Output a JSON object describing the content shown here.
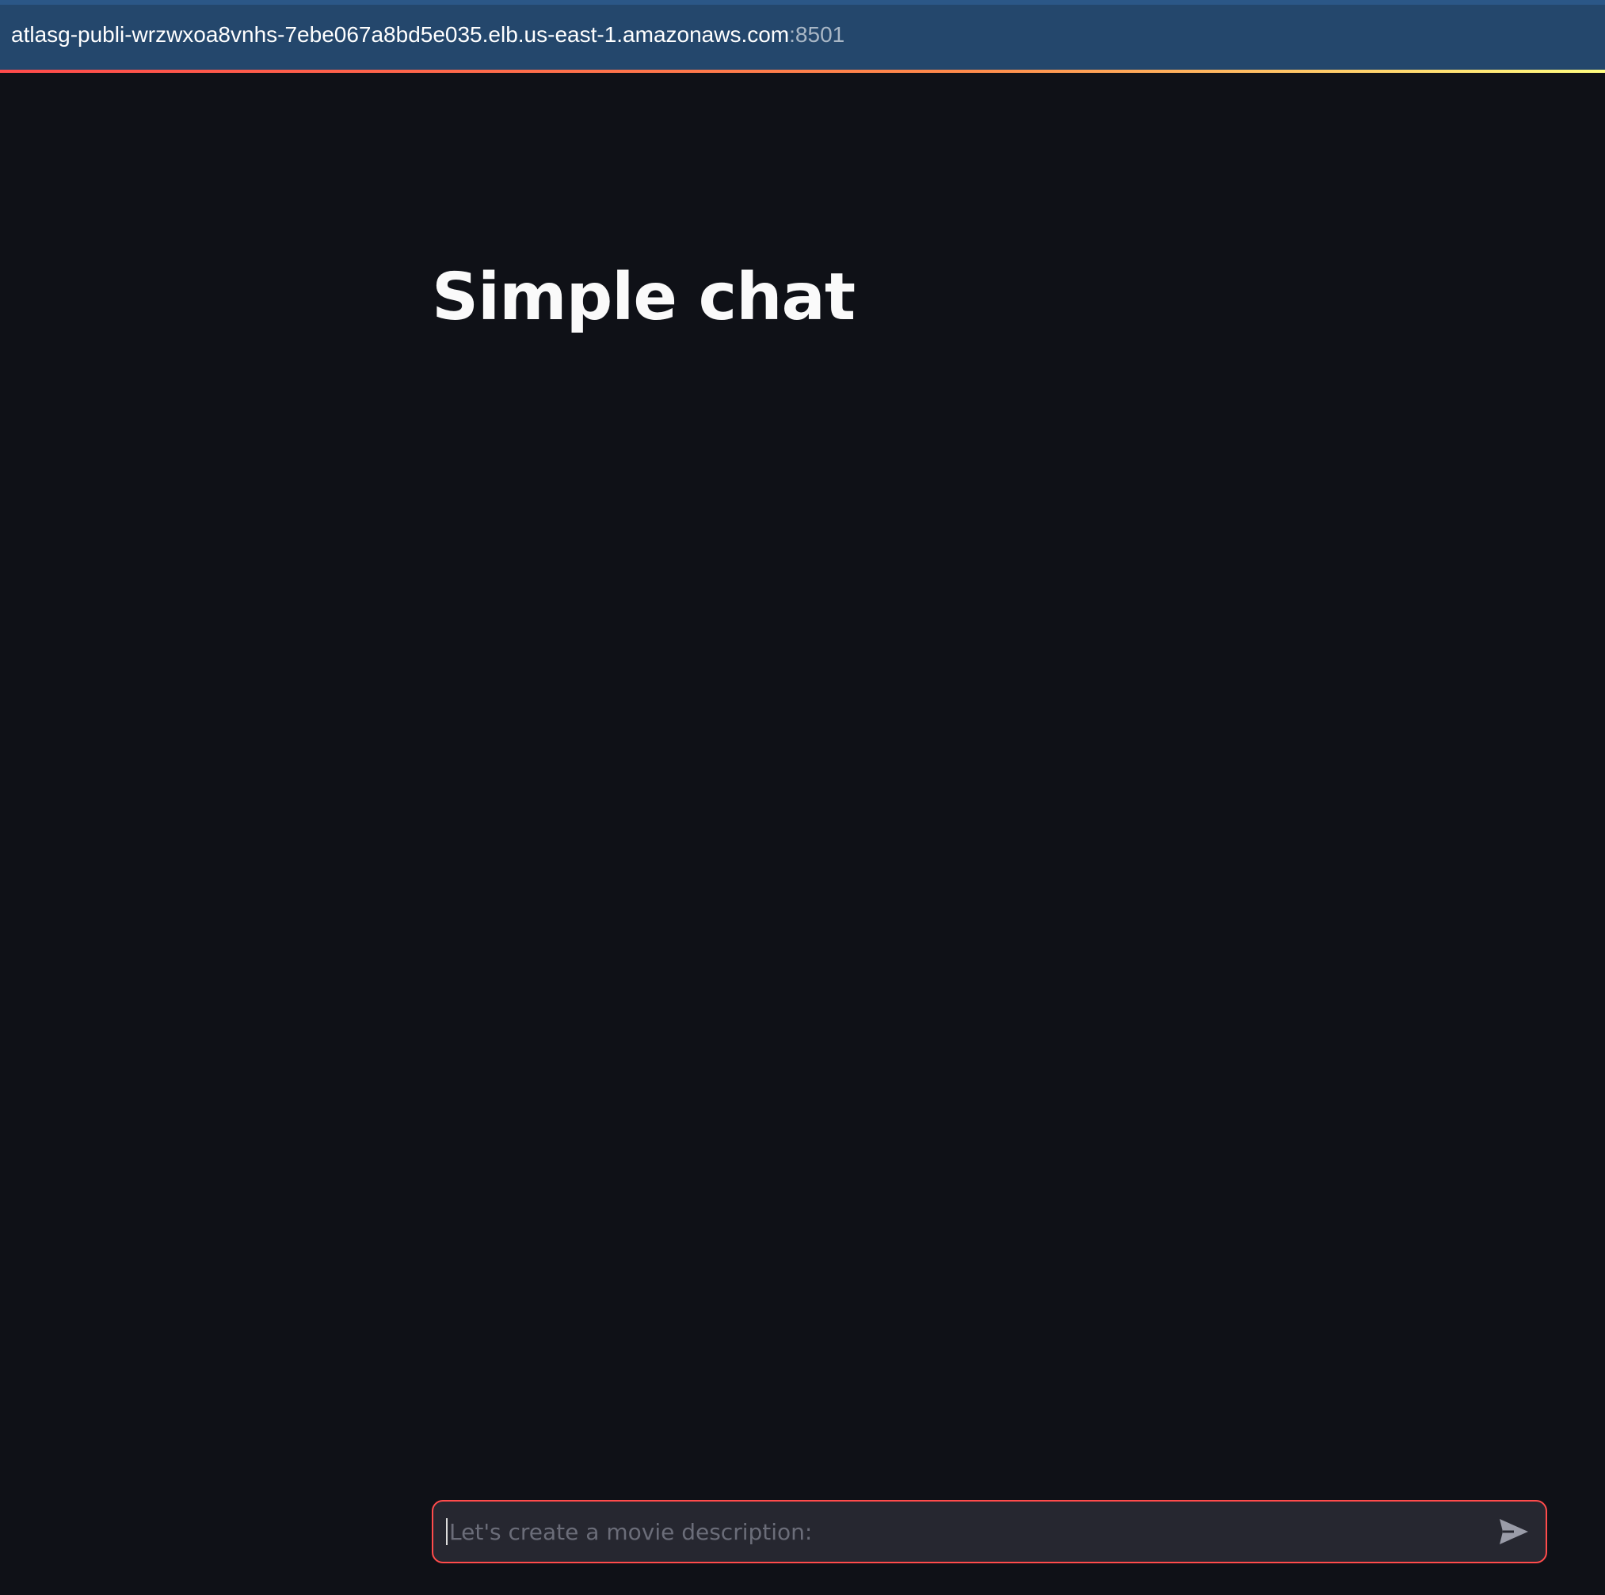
{
  "browser": {
    "url_host": "atlasg-publi-wrzwxoa8vnhs-7ebe067a8bd5e035.elb.us-east-1.amazonaws.com",
    "url_port": ":8501"
  },
  "main": {
    "title": "Simple chat"
  },
  "chat": {
    "placeholder": "Let's create a movie description:",
    "value": "",
    "send_icon": "send-icon"
  },
  "colors": {
    "background": "#0f1117",
    "address_bar": "#24476c",
    "accent": "#ff4b4b",
    "input_bg": "#262730"
  }
}
